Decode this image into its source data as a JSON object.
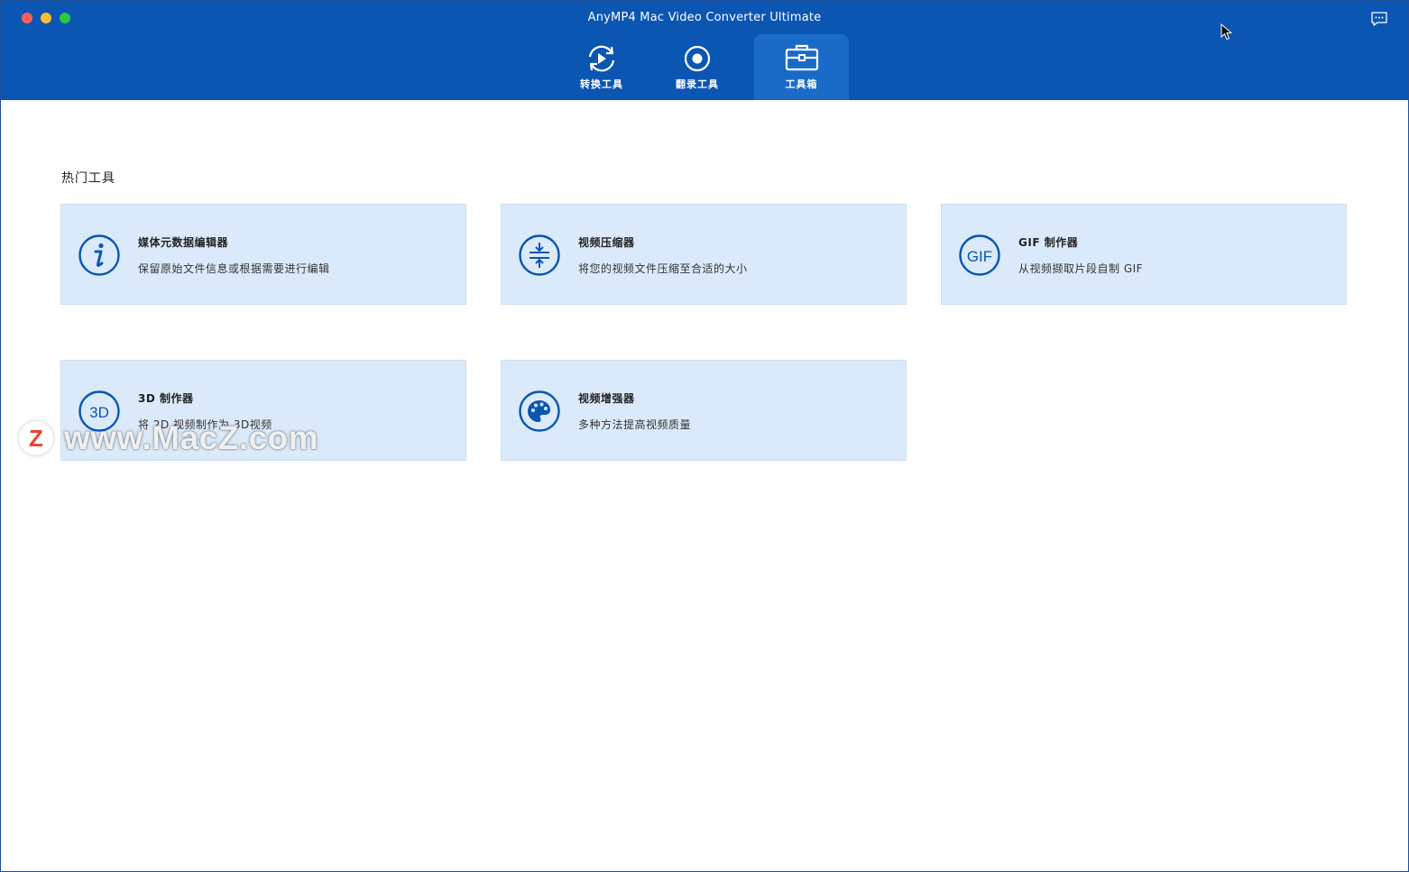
{
  "window": {
    "title": "AnyMP4 Mac Video Converter Ultimate"
  },
  "tabs": [
    {
      "label": "转换工具",
      "icon": "convert-icon",
      "active": false
    },
    {
      "label": "翻录工具",
      "icon": "record-icon",
      "active": false
    },
    {
      "label": "工具箱",
      "icon": "toolbox-icon",
      "active": true
    }
  ],
  "section": {
    "title": "热门工具"
  },
  "tools": [
    {
      "title": "媒体元数据编辑器",
      "desc": "保留原始文件信息或根据需要进行编辑",
      "icon": "info-icon"
    },
    {
      "title": "视频压缩器",
      "desc": "将您的视频文件压缩至合适的大小",
      "icon": "compress-icon"
    },
    {
      "title": "GIF 制作器",
      "desc": "从视频撷取片段自制 GIF",
      "icon": "gif-icon",
      "icon_text": "GIF"
    },
    {
      "title": "3D 制作器",
      "desc": "将 2D 视频制作为 3D视频",
      "icon": "3d-icon",
      "icon_text": "3D"
    },
    {
      "title": "视频增强器",
      "desc": "多种方法提高视频质量",
      "icon": "palette-icon"
    }
  ],
  "watermark": {
    "logo": "Z",
    "text": "www.MacZ.com"
  },
  "colors": {
    "header": "#0b56b3",
    "active_tab": "#1a6bc7",
    "card_bg": "#dbeafb",
    "icon": "#0b56b3"
  }
}
